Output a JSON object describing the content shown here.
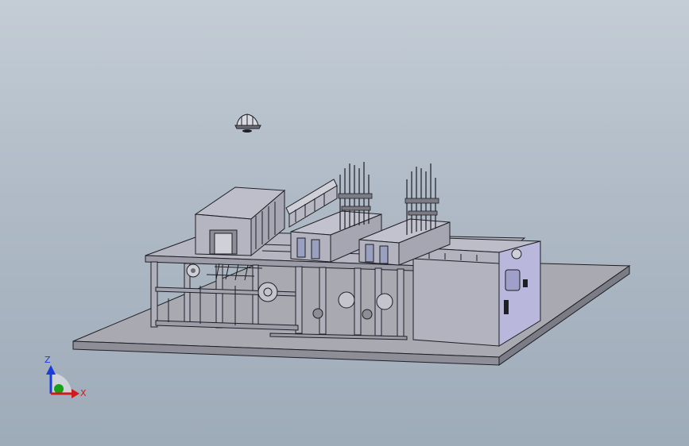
{
  "viewport": {
    "background_top": "#c4cdd6",
    "background_bottom": "#9eabb8"
  },
  "triad": {
    "z_label": "Z",
    "x_label": "X",
    "z_color": "#1a3cdb",
    "x_color": "#d11a1a",
    "y_color": "#18a018"
  },
  "view_orientation_icon": "view-orientation-icon",
  "model": {
    "part_color": "#b6b6c2",
    "edge_color": "#1e1e24",
    "base_plate_color": "#a9a9b2",
    "accent_panel_color": "#b9b8dc"
  }
}
